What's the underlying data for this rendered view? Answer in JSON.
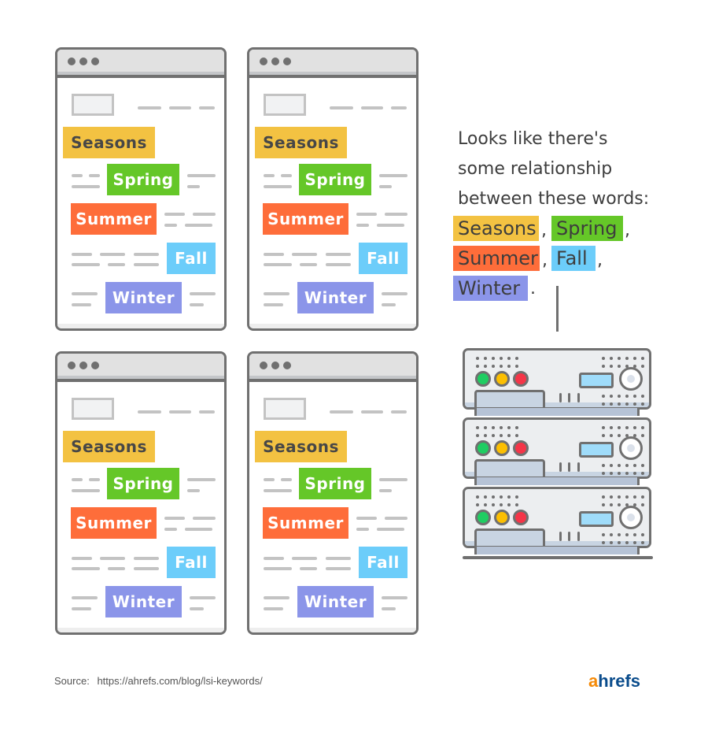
{
  "browser_windows": [
    {
      "tags": {
        "seasons": "Seasons",
        "spring": "Spring",
        "summer": "Summer",
        "fall": "Fall",
        "winter": "Winter"
      }
    },
    {
      "tags": {
        "seasons": "Seasons",
        "spring": "Spring",
        "summer": "Summer",
        "fall": "Fall",
        "winter": "Winter"
      }
    },
    {
      "tags": {
        "seasons": "Seasons",
        "spring": "Spring",
        "summer": "Summer",
        "fall": "Fall",
        "winter": "Winter"
      }
    },
    {
      "tags": {
        "seasons": "Seasons",
        "spring": "Spring",
        "summer": "Summer",
        "fall": "Fall",
        "winter": "Winter"
      }
    }
  ],
  "caption": {
    "lines": [
      "Looks like there's",
      "some relationship",
      "between these words:"
    ],
    "words": [
      "Seasons",
      "Spring",
      "Summer",
      "Fall",
      "Winter"
    ],
    "separator": ",",
    "terminator": "."
  },
  "colors": {
    "seasons": "#f3c242",
    "spring": "#65c728",
    "summer": "#fe6d3a",
    "fall": "#6ccdfa",
    "winter": "#8b95e9",
    "outline": "#707070"
  },
  "server_icon": {
    "units": 3,
    "leds": [
      "green",
      "yellow",
      "red"
    ]
  },
  "footer": {
    "source_label": "Source:",
    "source_url": "https://ahrefs.com/blog/lsi-keywords/",
    "logo_a": "a",
    "logo_rest": "hrefs"
  }
}
